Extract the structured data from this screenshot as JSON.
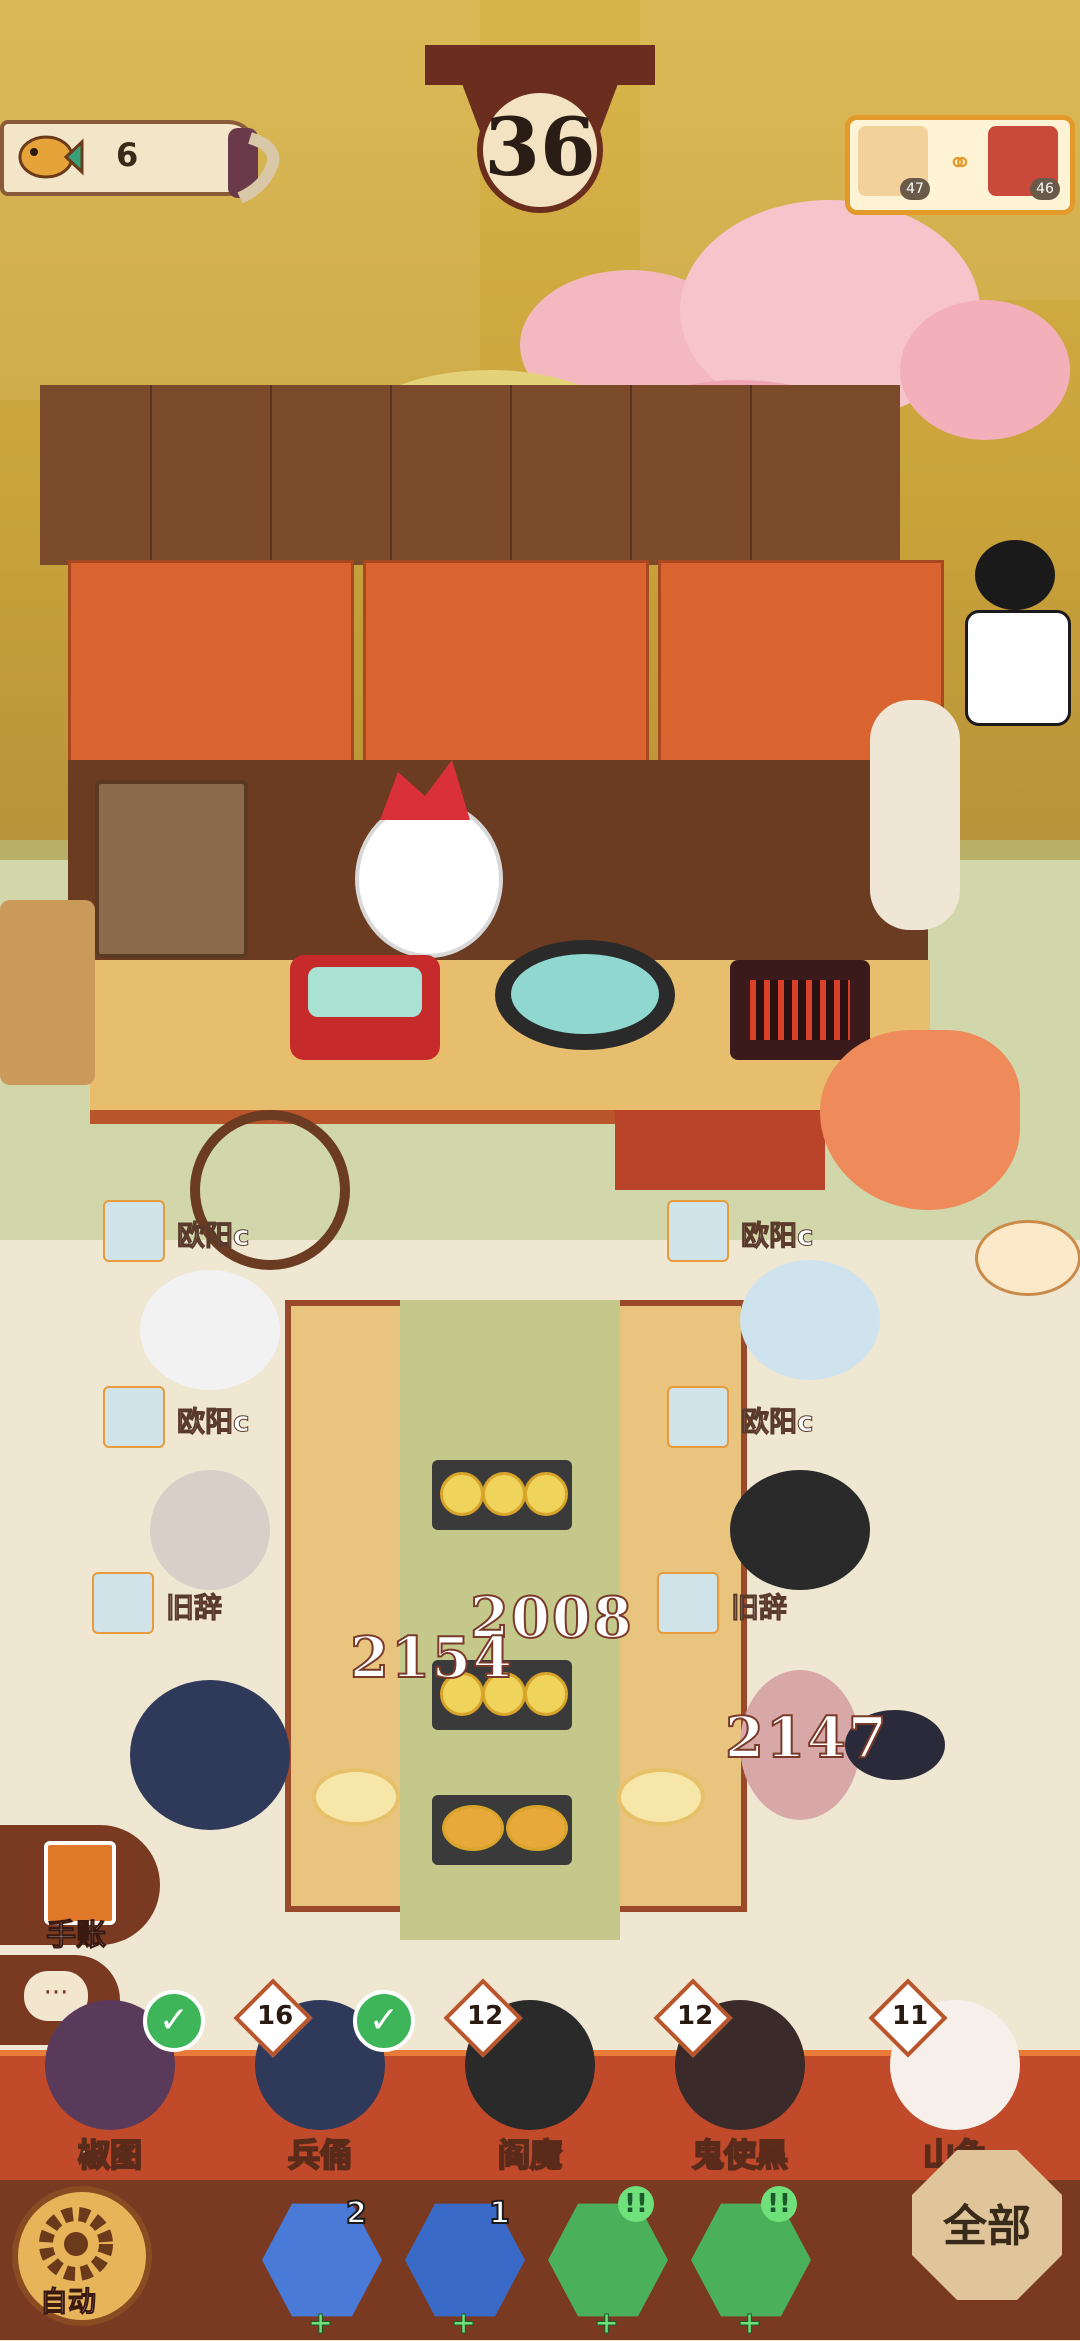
{
  "hud": {
    "coin_count": "6",
    "timer": "36",
    "duo": {
      "left_level": "47",
      "right_level": "46"
    }
  },
  "seats": [
    {
      "name": "欧阳c"
    },
    {
      "name": "欧阳c"
    },
    {
      "name": "欧阳c"
    },
    {
      "name": "欧阳c"
    },
    {
      "name": "旧辞"
    },
    {
      "name": "旧辞"
    }
  ],
  "scores": [
    "2008",
    "2154",
    "2147"
  ],
  "side_buttons": {
    "journal": "手账"
  },
  "roster": [
    {
      "name": "椒图",
      "level": "",
      "ready": true
    },
    {
      "name": "兵俑",
      "level": "16",
      "ready": true
    },
    {
      "name": "阎魔",
      "level": "12",
      "ready": false
    },
    {
      "name": "鬼使黑",
      "level": "12",
      "ready": false
    },
    {
      "name": "山兔",
      "level": "11",
      "ready": false
    }
  ],
  "bottom": {
    "auto_label": "自动",
    "all_label": "全部",
    "cards": [
      {
        "count": "2",
        "alert": ""
      },
      {
        "count": "1",
        "alert": ""
      },
      {
        "count": "",
        "alert": "!!"
      },
      {
        "count": "",
        "alert": "!!"
      }
    ]
  },
  "colors": {
    "accent": "#c04a2a",
    "gold": "#d8b54a",
    "ready_green": "#3fb55a"
  }
}
